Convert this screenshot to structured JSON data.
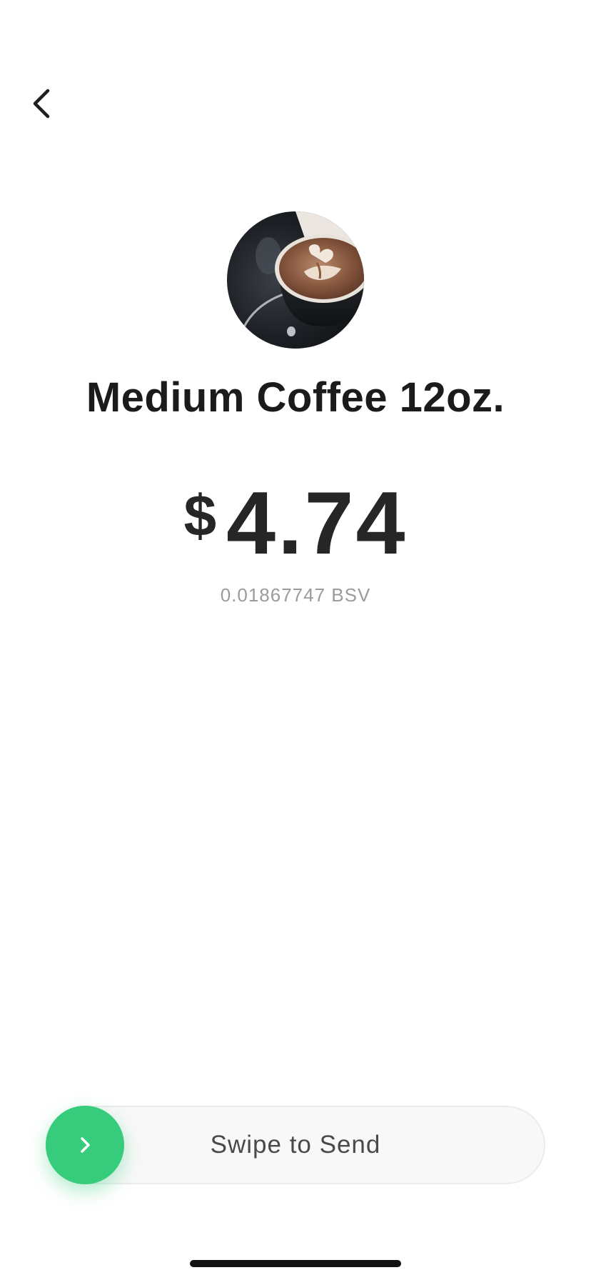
{
  "product": {
    "name": "Medium Coffee 12oz.",
    "image": "latte-art-coffee-cup-photo"
  },
  "price": {
    "currency_symbol": "$",
    "amount": "4.74",
    "crypto_amount": "0.01867747 BSV"
  },
  "actions": {
    "back_icon": "chevron-left-icon",
    "swipe_label": "Swipe to Send",
    "swipe_icon": "chevron-right-icon",
    "swipe_progress": 0
  },
  "colors": {
    "accent": "#36cc7c",
    "text_primary": "#1b1b1b",
    "text_secondary": "#9b9b9b",
    "track_bg": "#f8f8f8"
  }
}
